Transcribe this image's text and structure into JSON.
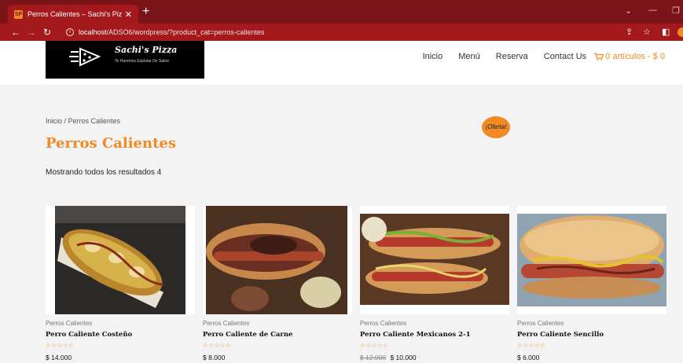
{
  "browser": {
    "tab_title": "Perros Calientes – Sachi's Pizza",
    "tab_close": "✕",
    "new_tab": "+",
    "url_host": "localhost",
    "url_path": "/ADSO6/wordpress/?product_cat=perros-calientes"
  },
  "site": {
    "brand": "Sachi's Pizza",
    "tagline": "Te Haremos Explotar De Sabor",
    "nav": [
      "Inicio",
      "Menú",
      "Reserva",
      "Contact Us"
    ],
    "cart_label": "0 artículos - $ 0"
  },
  "page": {
    "breadcrumb": "Inicio / Perros Calientes",
    "title": "Perros Calientes",
    "result_count": "Mostrando todos los resultados 4",
    "sale_badge": "¡Oferta!"
  },
  "products": [
    {
      "category": "Perros Calientes",
      "name": "Perro Caliente Costeño",
      "old_price": "",
      "price": "$ 14.000",
      "stars": "☆☆☆☆☆"
    },
    {
      "category": "Perros Calientes",
      "name": "Perro Caliente de Carne",
      "old_price": "",
      "price": "$ 8.000",
      "stars": "☆☆☆☆☆"
    },
    {
      "category": "Perros Calientes",
      "name": "Perro Caliente Mexicanos 2-1",
      "old_price": "$ 12.000",
      "price": "$ 10.000",
      "stars": "☆☆☆☆☆"
    },
    {
      "category": "Perros Calientes",
      "name": "Perro Caliente Sencillo",
      "old_price": "",
      "price": "$ 6.000",
      "stars": "☆☆☆☆☆"
    }
  ],
  "colors": {
    "accent": "#f08a24",
    "browser_frame": "#a3191c",
    "page_bg": "#f3f3f3"
  }
}
